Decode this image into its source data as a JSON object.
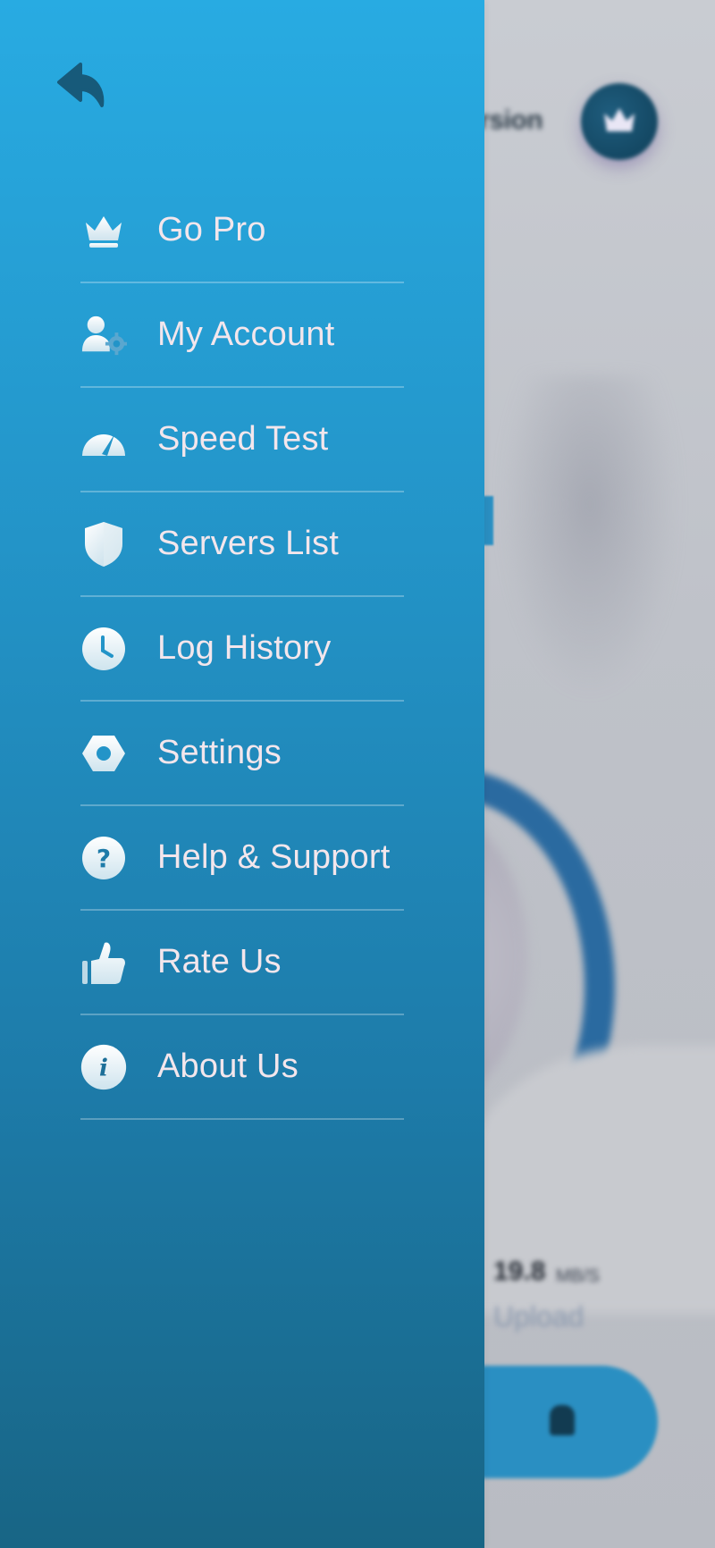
{
  "background": {
    "title_fragment": "ersion",
    "stats": {
      "upload_value": "19.8",
      "upload_unit": "MB/S",
      "upload_label": "Upload"
    }
  },
  "drawer": {
    "back_icon": "back-arrow-icon",
    "menu_items": [
      {
        "label": "Go Pro",
        "icon": "crown-icon"
      },
      {
        "label": "My Account",
        "icon": "user-gear-icon"
      },
      {
        "label": "Speed Test",
        "icon": "speedometer-icon"
      },
      {
        "label": "Servers List",
        "icon": "shield-icon"
      },
      {
        "label": "Log History",
        "icon": "clock-icon"
      },
      {
        "label": "Settings",
        "icon": "hex-nut-icon"
      },
      {
        "label": "Help & Support",
        "icon": "help-question-icon"
      },
      {
        "label": "Rate Us",
        "icon": "thumbs-up-icon"
      },
      {
        "label": "About Us",
        "icon": "info-icon"
      }
    ]
  },
  "colors": {
    "drawer_top": "#28abe2",
    "drawer_bottom": "#186585",
    "menu_text": "#f3e6ec",
    "icon_dark": "#175a7a"
  }
}
